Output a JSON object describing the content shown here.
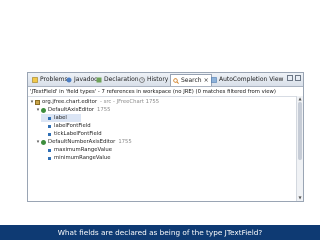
{
  "tabs": [
    {
      "label": "Problems",
      "icon": "problems-icon"
    },
    {
      "label": "Javadoc",
      "icon": "javadoc-icon"
    },
    {
      "label": "Declaration",
      "icon": "declaration-icon"
    },
    {
      "label": "History",
      "icon": "history-icon"
    },
    {
      "label": "Search",
      "icon": "search-icon",
      "active": true
    },
    {
      "label": "AutoCompletion View",
      "icon": "autocompletion-icon"
    }
  ],
  "search": {
    "status": "'JTextField' in 'field types' - 7 references in workspace (no JRE) (0 matches filtered from view)"
  },
  "tree": [
    {
      "label": "org.jfree.chart.editor",
      "hint": "- src - JFreeChart 1755",
      "icon": "package-icon"
    },
    {
      "label": "DefaultAxisEditor",
      "hint": "1755",
      "icon": "class-icon"
    },
    {
      "label": "label",
      "icon": "field-icon"
    },
    {
      "label": "labelFontField",
      "icon": "field-icon"
    },
    {
      "label": "tickLabelFontField",
      "icon": "field-icon"
    },
    {
      "label": "DefaultNumberAxisEditor",
      "hint": "1755",
      "icon": "class-icon"
    },
    {
      "label": "maximumRangeValue",
      "icon": "field-icon"
    },
    {
      "label": "minimumRangeValue",
      "icon": "field-icon"
    }
  ],
  "caption": "What fields are declared as being of the type JTextField?",
  "colors": {
    "caption_bg": "#0e3a73",
    "selection": "#dbe5f5"
  }
}
